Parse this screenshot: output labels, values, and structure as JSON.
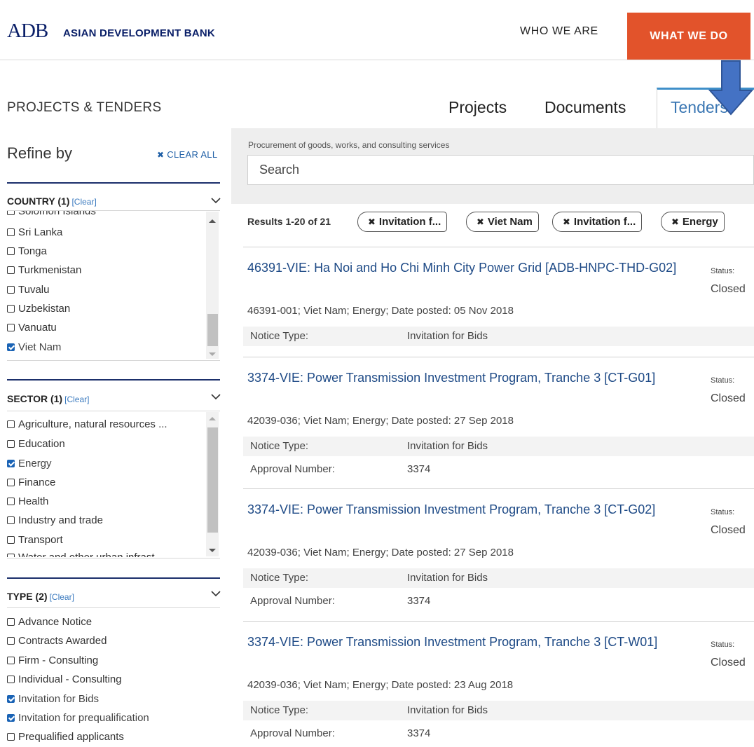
{
  "header": {
    "logo_mark": "ADB",
    "logo_text": "ASIAN DEVELOPMENT BANK",
    "nav": [
      {
        "label": "WHO WE ARE"
      },
      {
        "label": "WHAT WE DO",
        "active_color": "#e2532b"
      }
    ]
  },
  "section": {
    "title": "PROJECTS & TENDERS",
    "tabs": [
      {
        "label": "Projects"
      },
      {
        "label": "Documents"
      },
      {
        "label": "Tenders",
        "active": true
      }
    ]
  },
  "sidebar": {
    "title": "Refine by",
    "clear_all": "CLEAR ALL",
    "clear_all_icon": "x-icon",
    "facets": [
      {
        "name": "COUNTRY",
        "count": "(1)",
        "clear": "[Clear]",
        "partial_top": "Solomon Islands",
        "options": [
          {
            "label": "Sri Lanka",
            "checked": false
          },
          {
            "label": "Tonga",
            "checked": false
          },
          {
            "label": "Turkmenistan",
            "checked": false
          },
          {
            "label": "Tuvalu",
            "checked": false
          },
          {
            "label": "Uzbekistan",
            "checked": false
          },
          {
            "label": "Vanuatu",
            "checked": false
          },
          {
            "label": "Viet Nam",
            "checked": true
          }
        ]
      },
      {
        "name": "SECTOR",
        "count": "(1)",
        "clear": "[Clear]",
        "options": [
          {
            "label": "Agriculture, natural resources ...",
            "checked": false
          },
          {
            "label": "Education",
            "checked": false
          },
          {
            "label": "Energy",
            "checked": true
          },
          {
            "label": "Finance",
            "checked": false
          },
          {
            "label": "Health",
            "checked": false
          },
          {
            "label": "Industry and trade",
            "checked": false
          },
          {
            "label": "Transport",
            "checked": false
          }
        ],
        "partial_bottom": "Water and other urban infrast..."
      },
      {
        "name": "TYPE",
        "count": "(2)",
        "clear": "[Clear]",
        "options": [
          {
            "label": "Advance Notice",
            "checked": false
          },
          {
            "label": "Contracts Awarded",
            "checked": false
          },
          {
            "label": "Firm - Consulting",
            "checked": false
          },
          {
            "label": "Individual - Consulting",
            "checked": false
          },
          {
            "label": "Invitation for Bids",
            "checked": true
          },
          {
            "label": "Invitation for prequalification",
            "checked": true
          },
          {
            "label": "Prequalified applicants",
            "checked": false
          }
        ]
      }
    ]
  },
  "search": {
    "caption": "Procurement of goods, works, and consulting services",
    "placeholder": "Search",
    "value": ""
  },
  "results": {
    "count_text": "Results 1-20 of 21",
    "chips": [
      {
        "label": "Invitation f..."
      },
      {
        "label": "Viet Nam"
      },
      {
        "label": "Invitation f..."
      },
      {
        "label": "Energy"
      }
    ],
    "items": [
      {
        "title": "46391-VIE: Ha Noi and Ho Chi Minh City Power Grid [ADB-HNPC-THD-G02]",
        "meta": "46391-001; Viet Nam; Energy; Date posted: 05 Nov 2018",
        "status_label": "Status:",
        "status": "Closed",
        "rows": [
          {
            "key": "Notice Type:",
            "value": "Invitation for Bids"
          }
        ]
      },
      {
        "title": "3374-VIE: Power Transmission Investment Program, Tranche 3 [CT-G01]",
        "meta": "42039-036; Viet Nam; Energy; Date posted: 27 Sep 2018",
        "status_label": "Status:",
        "status": "Closed",
        "rows": [
          {
            "key": "Notice Type:",
            "value": "Invitation for Bids"
          },
          {
            "key": "Approval Number:",
            "value": "3374"
          }
        ]
      },
      {
        "title": "3374-VIE: Power Transmission Investment Program, Tranche 3 [CT-G02]",
        "meta": "42039-036; Viet Nam; Energy; Date posted: 27 Sep 2018",
        "status_label": "Status:",
        "status": "Closed",
        "rows": [
          {
            "key": "Notice Type:",
            "value": "Invitation for Bids"
          },
          {
            "key": "Approval Number:",
            "value": "3374"
          }
        ]
      },
      {
        "title": "3374-VIE: Power Transmission Investment Program, Tranche 3 [CT-W01]",
        "meta": "42039-036; Viet Nam; Energy; Date posted: 23 Aug 2018",
        "status_label": "Status:",
        "status": "Closed",
        "rows": [
          {
            "key": "Notice Type:",
            "value": "Invitation for Bids"
          },
          {
            "key": "Approval Number:",
            "value": "3374"
          }
        ]
      }
    ]
  },
  "overlay": {
    "annotation_arrow_color": "#4472c4"
  }
}
